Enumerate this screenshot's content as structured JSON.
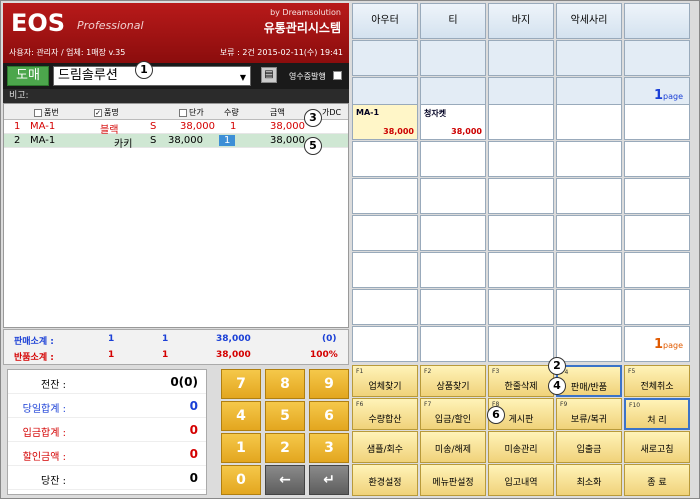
{
  "header": {
    "logo": "EOS",
    "logo_sub": "Professional",
    "by": "by Dreamsolution",
    "system_name": "유통관리시스템",
    "user_line": "사용자: 관리자 / 업체: 1매장 v.35",
    "hold_line": "보류 : 2건  2015-02-11(수) 19:41"
  },
  "toolbar": {
    "mode_button": "도매",
    "customer_value": "드림솔루션",
    "receipt_label": "영수증발행"
  },
  "memo_label": "비고:",
  "grid": {
    "headers": [
      "품번",
      "품명",
      "단가",
      "수량",
      "금액",
      "가DC"
    ],
    "rows": [
      {
        "no": "1",
        "code": "MA-1",
        "color": "블랙",
        "size": "S",
        "price": "38,000",
        "qty": "1",
        "amount": "38,000"
      },
      {
        "no": "2",
        "code": "MA-1",
        "color": "카키",
        "size": "S",
        "price": "38,000",
        "qty": "1",
        "amount": "38,000"
      }
    ]
  },
  "summary": {
    "sale_label": "판매소계 :",
    "sale_a": "1",
    "sale_b": "1",
    "sale_amount": "38,000",
    "sale_extra": "(0)",
    "return_label": "반품소계 :",
    "ret_a": "1",
    "ret_b": "1",
    "ret_amount": "38,000",
    "ret_extra": "100%"
  },
  "totals": [
    {
      "label": "전잔 :",
      "value": "0(0)",
      "color": "#000000"
    },
    {
      "label": "당일합계 :",
      "value": "0",
      "color": "#1a3fd6"
    },
    {
      "label": "입금합계 :",
      "value": "0",
      "color": "#d40000"
    },
    {
      "label": "할인금액 :",
      "value": "0",
      "color": "#d40000"
    },
    {
      "label": "당잔 :",
      "value": "0",
      "color": "#000000"
    }
  ],
  "keypad": [
    "7",
    "8",
    "9",
    "4",
    "5",
    "6",
    "1",
    "2",
    "3",
    "0",
    "←",
    "↵"
  ],
  "categories": [
    "아우터",
    "티",
    "바지",
    "악세사리",
    ""
  ],
  "products": [
    {
      "name": "MA-1",
      "price": "38,000"
    },
    {
      "name": "청자켓",
      "price": "38,000"
    }
  ],
  "page_top": "1",
  "page_bottom": "1",
  "page_word": "page",
  "fkeys": [
    {
      "key": "F1",
      "label": "업체찾기"
    },
    {
      "key": "F2",
      "label": "상품찾기"
    },
    {
      "key": "F3",
      "label": "한줄삭제"
    },
    {
      "key": "F4",
      "label": "판매/반품"
    },
    {
      "key": "F5",
      "label": "전체취소"
    },
    {
      "key": "F6",
      "label": "수량합산"
    },
    {
      "key": "F7",
      "label": "입금/할인"
    },
    {
      "key": "F8",
      "label": "게시판"
    },
    {
      "key": "F9",
      "label": "보류/복귀"
    },
    {
      "key": "F10",
      "label": "처 리"
    },
    {
      "key": "",
      "label": "샘플/회수"
    },
    {
      "key": "",
      "label": "미송/해제"
    },
    {
      "key": "",
      "label": "미송관리"
    },
    {
      "key": "",
      "label": "입출금"
    },
    {
      "key": "",
      "label": "새로고침"
    },
    {
      "key": "",
      "label": "환경설정"
    },
    {
      "key": "",
      "label": "메뉴판설정"
    },
    {
      "key": "",
      "label": "입고내역"
    },
    {
      "key": "",
      "label": "최소화"
    },
    {
      "key": "",
      "label": "종  료"
    }
  ],
  "callouts": [
    "1",
    "2",
    "3",
    "4",
    "5",
    "6"
  ]
}
